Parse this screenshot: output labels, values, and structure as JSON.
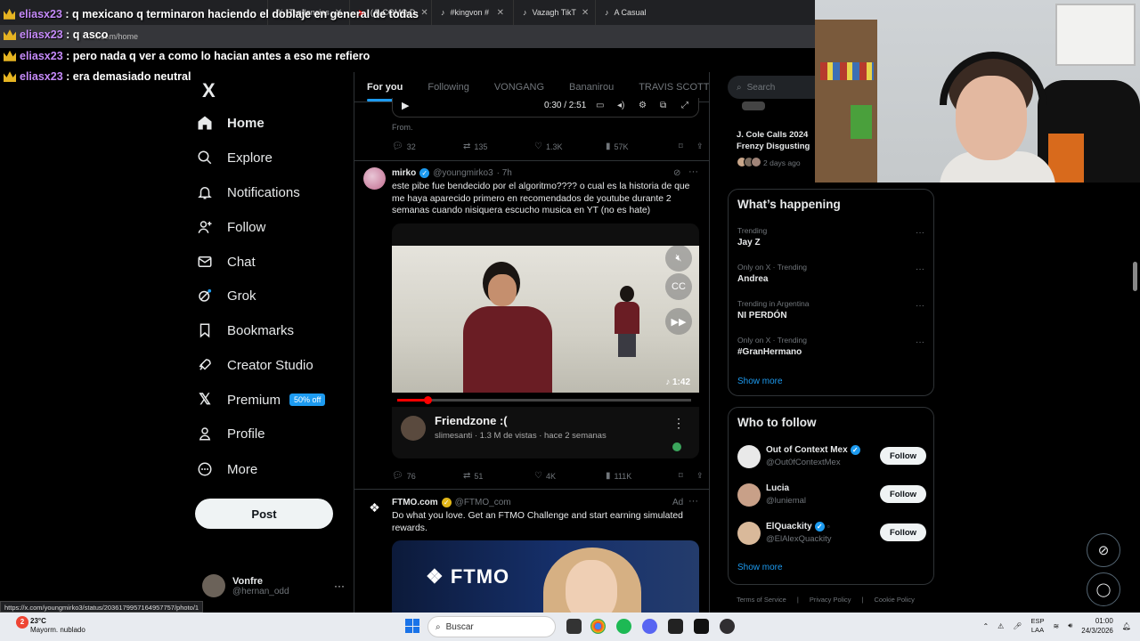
{
  "browser": {
    "tabs": [
      {
        "label": "Tendencias",
        "icon": "x-icon"
      },
      {
        "label": "(4) COMO D",
        "icon": "youtube-icon"
      },
      {
        "label": "#kingvon #",
        "icon": "tiktok-icon"
      },
      {
        "label": "Vazagh TikT",
        "icon": "tiktok-icon"
      },
      {
        "label": "A Casual",
        "icon": "tiktok-icon"
      }
    ],
    "address": "x.com/home",
    "status_url": "https://x.com/youngmirko3/status/2036179957164957757/photo/1"
  },
  "chat_overlay": [
    {
      "user": "eliasx23",
      "message": "q mexicano q terminaron haciendo el doblaje en general de todas"
    },
    {
      "user": "eliasx23",
      "message": "q asco"
    },
    {
      "user": "eliasx23",
      "message": "pero nada q ver a como lo hacian antes a eso me refiero"
    },
    {
      "user": "eliasx23",
      "message": "era demasiado neutral"
    }
  ],
  "nav": {
    "logo": "X",
    "items": [
      {
        "label": "Home",
        "icon": "home-icon"
      },
      {
        "label": "Explore",
        "icon": "search-icon"
      },
      {
        "label": "Notifications",
        "icon": "bell-icon"
      },
      {
        "label": "Follow",
        "icon": "follow-icon"
      },
      {
        "label": "Chat",
        "icon": "mail-icon"
      },
      {
        "label": "Grok",
        "icon": "grok-icon"
      },
      {
        "label": "Bookmarks",
        "icon": "bookmark-icon"
      },
      {
        "label": "Creator Studio",
        "icon": "rocket-icon"
      },
      {
        "label": "Premium",
        "icon": "x-icon"
      },
      {
        "label": "Profile",
        "icon": "person-icon"
      },
      {
        "label": "More",
        "icon": "more-icon"
      }
    ],
    "premium_badge": "50% off",
    "post_button": "Post",
    "account": {
      "name": "Vonfre",
      "handle": "@hernan_odd"
    }
  },
  "feed": {
    "tabs": [
      "For you",
      "Following",
      "VONGANG",
      "Bananirou",
      "TRAVIS SCOTT"
    ],
    "prev_tweet": {
      "player_time": "0:30 / 2:51",
      "from_label": "From",
      "stats": {
        "replies": "32",
        "reposts": "135",
        "likes": "1.3K",
        "views": "57K"
      }
    },
    "tweet": {
      "name": "mirko",
      "handle": "@youngmirko3",
      "time": "· 7h",
      "text": "este pibe fue bendecido por el algoritmo???? o cual es la historia de que me haya aparecido primero en recomendados de youtube durante 2 semanas cuando nisiquera escucho musica en YT  (no es hate)",
      "video_duration": "1:42",
      "video_progress": 0.09,
      "yt_title": "Friendzone :(",
      "yt_meta": "slimesanti  · 1.3 M de vistas · hace 2 semanas",
      "stats": {
        "replies": "76",
        "reposts": "51",
        "likes": "4K",
        "views": "111K"
      }
    },
    "ad": {
      "name": "FTMO.com",
      "handle": "@FTMO_com",
      "ad_label": "Ad",
      "text": "Do what you love. Get an FTMO Challenge and start earning simulated rewards.",
      "logo_text": "FTMO"
    }
  },
  "right": {
    "search_placeholder": "Search",
    "jcole": {
      "title": "J. Cole Calls 2024 Frenzy Disgusting",
      "meta": "2 days ago"
    },
    "happening": {
      "title": "What’s happening",
      "trends": [
        {
          "category": "Trending",
          "name": "Jay Z"
        },
        {
          "category": "Only on X · Trending",
          "name": "Andrea"
        },
        {
          "category": "Trending in Argentina",
          "name": "NI PERDÓN"
        },
        {
          "category": "Only on X · Trending",
          "name": "#GranHermano"
        }
      ],
      "show_more": "Show more"
    },
    "who_to_follow": {
      "title": "Who to follow",
      "accounts": [
        {
          "name": "Out of Context Mex",
          "handle": "@Out0fContextMex",
          "button": "Follow"
        },
        {
          "name": "Lucia",
          "handle": "@luniemal",
          "button": "Follow"
        },
        {
          "name": "ElQuackity",
          "handle": "@ElAlexQuackity",
          "button": "Follow"
        }
      ],
      "show_more": "Show more"
    },
    "footer": [
      "Terms of Service",
      "Privacy Policy",
      "Cookie Policy"
    ]
  },
  "taskbar": {
    "weather_temp": "23°C",
    "weather_desc": "Mayorm. nublado",
    "search": "Buscar",
    "lang_top": "ESP",
    "lang_bottom": "LAA",
    "time": "01:00",
    "date": "24/3/2026",
    "notif_count": "2"
  }
}
